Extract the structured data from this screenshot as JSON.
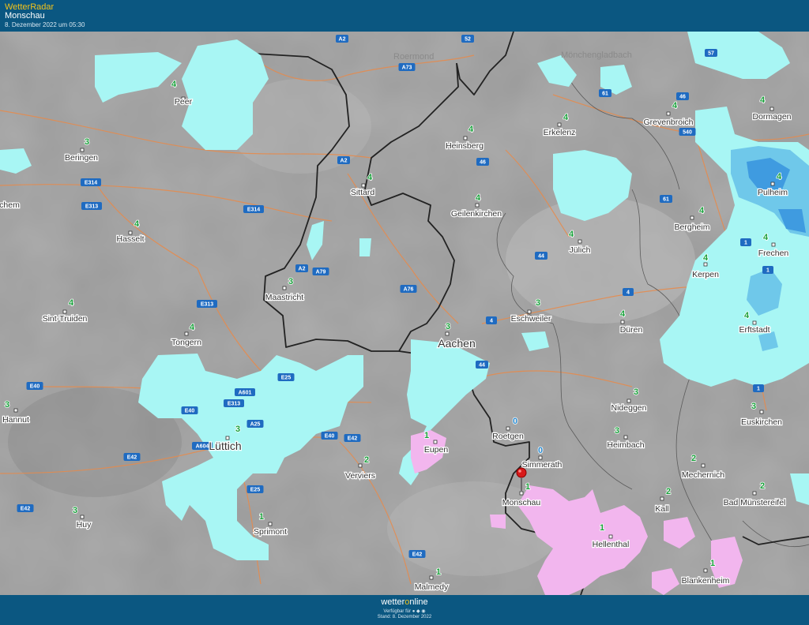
{
  "header": {
    "brand": "WetterRadar",
    "location": "Monschau",
    "timestamp": "8. Dezember 2022 um 05:30"
  },
  "footer": {
    "logo_pre": "wetter",
    "logo_o": "o",
    "logo_post": "nline",
    "app_text": "Verfügbar für ● ◆ ◉",
    "stand": "Stand: 8. Dezember 2022"
  },
  "colors": {
    "header_bg": "#0b5781",
    "rain": "#a8f6f4",
    "rain_heavy": "#6fc8ea",
    "snow": "#f2b6ee",
    "value_green": "#18a03a",
    "value_blue": "#2a8bd0",
    "border": "#222222",
    "road": "#e88a4a",
    "marker": "#d81a1a"
  },
  "map": {
    "faded_labels": [
      "Mönchengladbach",
      "Roermond"
    ],
    "cities": [
      {
        "name": "Peer",
        "value": "4"
      },
      {
        "name": "Beringen",
        "value": "3"
      },
      {
        "name": "Hasselt",
        "value": "4"
      },
      {
        "name": "Sint-Truiden",
        "value": "4"
      },
      {
        "name": "Tongern",
        "value": "4"
      },
      {
        "name": "Hannut",
        "value": "3"
      },
      {
        "name": "Huy",
        "value": "3"
      },
      {
        "name": "Lüttich",
        "value": "3"
      },
      {
        "name": "Sprimont",
        "value": "1"
      },
      {
        "name": "Verviers",
        "value": "2"
      },
      {
        "name": "Eupen",
        "value": "1"
      },
      {
        "name": "Malmedy",
        "value": "1"
      },
      {
        "name": "Maastricht",
        "value": "3"
      },
      {
        "name": "Sittard",
        "value": "4"
      },
      {
        "name": "Heinsberg",
        "value": "4"
      },
      {
        "name": "Erkelenz",
        "value": "4"
      },
      {
        "name": "Geilenkirchen",
        "value": "4"
      },
      {
        "name": "Aachen",
        "value": "3"
      },
      {
        "name": "Eschweiler",
        "value": "3"
      },
      {
        "name": "Jülich",
        "value": "4"
      },
      {
        "name": "Düren",
        "value": "4"
      },
      {
        "name": "Roetgen",
        "value": "0"
      },
      {
        "name": "Simmerath",
        "value": "0"
      },
      {
        "name": "Monschau",
        "value": "1"
      },
      {
        "name": "Hellenthal",
        "value": "1"
      },
      {
        "name": "Heimbach",
        "value": "3"
      },
      {
        "name": "Nideggen",
        "value": "3"
      },
      {
        "name": "Grevenbroich",
        "value": "4"
      },
      {
        "name": "Dormagen",
        "value": "4"
      },
      {
        "name": "Pulheim",
        "value": "4"
      },
      {
        "name": "Bergheim",
        "value": "4"
      },
      {
        "name": "Frechen",
        "value": "4"
      },
      {
        "name": "Kerpen",
        "value": "4"
      },
      {
        "name": "Erftstadt",
        "value": "4"
      },
      {
        "name": "Euskirchen",
        "value": "3"
      },
      {
        "name": "Mechernich",
        "value": "2"
      },
      {
        "name": "Bad Münstereifel",
        "value": "2"
      },
      {
        "name": "Kall",
        "value": "2"
      },
      {
        "name": "Blankenheim",
        "value": "1"
      },
      {
        "name": "chem",
        "value": ""
      }
    ],
    "roads": [
      "A2",
      "A73",
      "52",
      "57",
      "61",
      "46",
      "540",
      "A2",
      "46",
      "E314",
      "E313",
      "E314",
      "A2",
      "A79",
      "A76",
      "61",
      "44",
      "E313",
      "4",
      "4",
      "1",
      "44",
      "E40",
      "A601",
      "E313",
      "E25",
      "A25",
      "E40",
      "E40",
      "E42",
      "A604",
      "E42",
      "E25",
      "E42",
      "E42",
      "1",
      "1"
    ]
  }
}
